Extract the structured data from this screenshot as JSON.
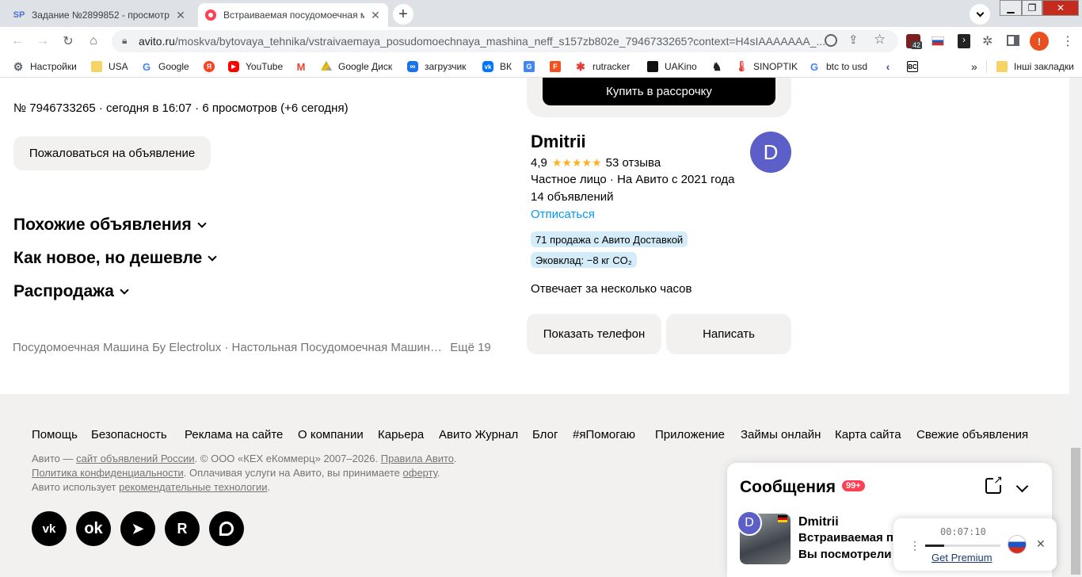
{
  "tabs": [
    {
      "icon": "SP",
      "title": "Задание №2899852 - просмотр"
    },
    {
      "icon": "avito",
      "title": "Встраиваемая посудомоечная м"
    }
  ],
  "toolbar": {
    "url_host": "avito.ru",
    "url_path": "/moskva/bytovaya_tehnika/vstraivaemaya_posudomoechnaya_mashina_neff_s157zb802e_7946733265?context=H4sIAAAAAAA_...",
    "ext_badge": "42",
    "profile_letter": "!"
  },
  "bookmarks": [
    {
      "label": "Настройки",
      "icon": "gear-icon"
    },
    {
      "label": "USA",
      "icon": "folder-icon"
    },
    {
      "label": "Google",
      "icon": "google-icon"
    },
    {
      "label": "",
      "icon": "yandex-icon"
    },
    {
      "label": "YouTube",
      "icon": "youtube-icon"
    },
    {
      "label": "",
      "icon": "gmail-icon"
    },
    {
      "label": "Google Диск",
      "icon": "drive-icon"
    },
    {
      "label": "загрузчик",
      "icon": "loop-icon"
    },
    {
      "label": "ВК",
      "icon": "vk-icon"
    },
    {
      "label": "",
      "icon": "translate-icon"
    },
    {
      "label": "",
      "icon": "f-icon"
    },
    {
      "label": "rutracker",
      "icon": "rutracker-icon"
    },
    {
      "label": "UAKino",
      "icon": "uakino-icon"
    },
    {
      "label": "",
      "icon": "chess-icon"
    },
    {
      "label": "SINOPTIK",
      "icon": "thermometer-icon"
    },
    {
      "label": "btc to usd",
      "icon": "google-icon"
    },
    {
      "label": "",
      "icon": "arrow-icon"
    },
    {
      "label": "",
      "icon": "bc-icon"
    }
  ],
  "bookmarks_more": "»",
  "other_bookmarks": "Інші закладки",
  "listing": {
    "meta": "№ 7946733265 · сегодня в 16:07 · 6 просмотров (+6 сегодня)",
    "report_button": "Пожаловаться на объявление",
    "sections": [
      "Похожие объявления",
      "Как новое, но дешевле",
      "Распродажа"
    ],
    "related_links": "Посудомоечная Машина Бу Electrolux · Настольная Посудомоечная Машин…",
    "more_link": "Ещё 19"
  },
  "seller": {
    "buy_installment": "Купить в рассрочку",
    "name": "Dmitrii",
    "avatar_letter": "D",
    "rating": "4,9",
    "stars": 5,
    "reviews": "53 отзыва",
    "type": "Частное лицо · На Авито с 2021 года",
    "ads_count": "14 объявлений",
    "unsubscribe": "Отписаться",
    "badge_delivery": "71 продажа с Авито Доставкой",
    "badge_eco": "Эковклад: −8 кг CO₂",
    "response": "Отвечает за несколько часов",
    "show_phone": "Показать телефон",
    "write": "Написать"
  },
  "footer": {
    "links": [
      "Помощь",
      "Безопасность",
      "Реклама на сайте",
      "О компании",
      "Карьера",
      "Авито Журнал",
      "Блог",
      "#яПомогаю",
      "Приложение",
      "Займы онлайн",
      "Карта сайта",
      "Свежие объявления"
    ],
    "line1_a": "Авито — ",
    "line1_link": "сайт объявлений России",
    "line1_b": ". © ООО «КЕХ еКоммерц» 2007–2026. ",
    "line1_link2": "Правила Авито",
    "line1_c": ".",
    "line2_link": "Политика конфиденциальности",
    "line2_b": ". Оплачивая услуги на Авито, вы принимаете ",
    "line2_link2": "оферту",
    "line2_c": ".",
    "line3_a": "Авито использует ",
    "line3_link": "рекомендательные технологии",
    "line3_b": ".",
    "social": [
      "vk-icon",
      "ok-icon",
      "telegram-icon",
      "rutube-icon",
      "dzen-icon"
    ]
  },
  "messages": {
    "title": "Сообщения",
    "count": "99+",
    "sender": "Dmitrii",
    "avatar_letter": "D",
    "subject": "Встраиваемая п",
    "preview": "Вы посмотрели"
  },
  "player": {
    "time": "00:07:10",
    "premium": "Get Premium",
    "progress": 0.25
  }
}
